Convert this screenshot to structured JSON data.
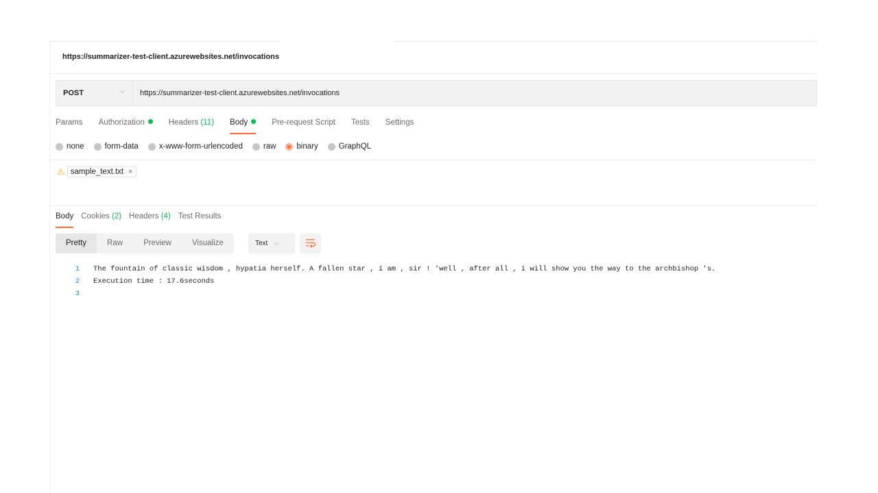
{
  "request": {
    "title": "https://summarizer-test-client.azurewebsites.net/invocations",
    "method": "POST",
    "url": "https://summarizer-test-client.azurewebsites.net/invocations"
  },
  "request_tabs": [
    {
      "label": "Params"
    },
    {
      "label": "Authorization"
    },
    {
      "label": "Headers",
      "count": "(11)"
    },
    {
      "label": "Body"
    },
    {
      "label": "Pre-request Script"
    },
    {
      "label": "Tests"
    },
    {
      "label": "Settings"
    }
  ],
  "body_types": [
    "none",
    "form-data",
    "x-www-form-urlencoded",
    "raw",
    "binary",
    "GraphQL"
  ],
  "selected_body_type": "binary",
  "file": {
    "name": "sample_text.txt",
    "remove": "×",
    "warning_icon": "⚠"
  },
  "response_tabs": [
    {
      "label": "Body"
    },
    {
      "label": "Cookies",
      "count": "(2)"
    },
    {
      "label": "Headers",
      "count": "(4)"
    },
    {
      "label": "Test Results"
    }
  ],
  "view_tabs": [
    "Pretty",
    "Raw",
    "Preview",
    "Visualize"
  ],
  "format": {
    "value": "Text",
    "chevron": "⌵"
  },
  "response_lines": [
    {
      "num": "1",
      "text": "The fountain of classic wisdom , hypatia herself. A fallen star , i am , sir ! 'well , after all , i will show you the way to the archbishop 's."
    },
    {
      "num": "2",
      "text": "Execution time : 17.6seconds"
    },
    {
      "num": "3",
      "text": ""
    }
  ],
  "colors": {
    "accent": "#ff6c37",
    "success": "#0cbb52",
    "line_number": "#1a86c9"
  },
  "icons": {
    "method_chevron": "chevron-down-icon",
    "wrap": "word-wrap-icon",
    "warning": "warning-icon",
    "close": "close-icon"
  }
}
